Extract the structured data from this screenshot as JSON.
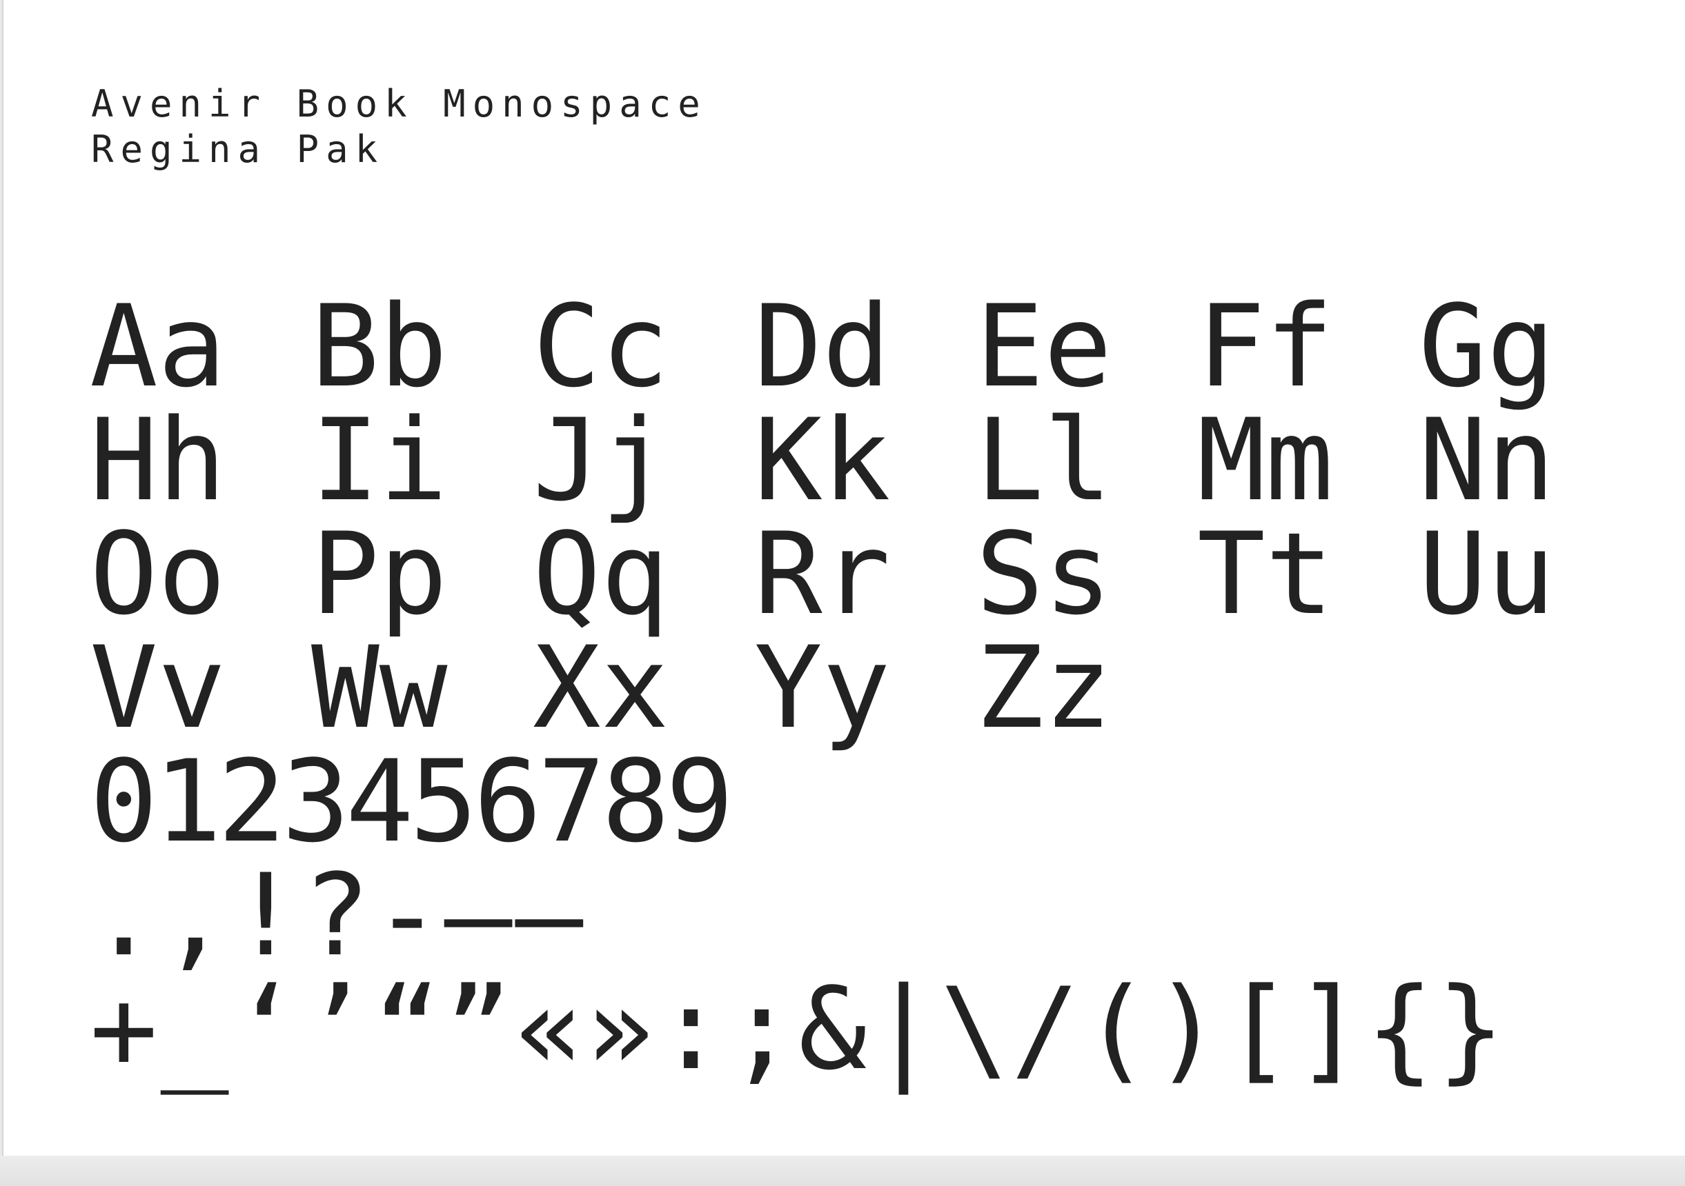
{
  "header": {
    "font_name": "Avenir Book Monospace",
    "author": "Regina Pak"
  },
  "specimen": {
    "alphabet_rows": [
      [
        "Aa",
        "Bb",
        "Cc",
        "Dd",
        "Ee",
        "Ff",
        "Gg"
      ],
      [
        "Hh",
        "Ii",
        "Jj",
        "Kk",
        "Ll",
        "Mm",
        "Nn"
      ],
      [
        "Oo",
        "Pp",
        "Qq",
        "Rr",
        "Ss",
        "Tt",
        "Uu"
      ],
      [
        "Vv",
        "Ww",
        "Xx",
        "Yy",
        "Zz"
      ]
    ],
    "digits": "0123456789",
    "punctuation_1": ".,!?-–—",
    "punctuation_2": "+_‘’“”«»:;&|\\/()[]{}"
  },
  "colors": {
    "ink": "#222222",
    "paper": "#ffffff",
    "background": "#e9e9e9"
  }
}
